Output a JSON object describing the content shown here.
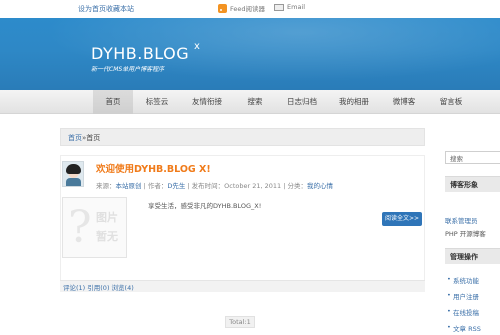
{
  "topbar": {
    "bookmark_link": "设为首页收藏本站",
    "feed_label": "Feed阅读器",
    "email_label": "Email",
    "feed_icon": "rss-icon",
    "email_icon": "mail-icon"
  },
  "header": {
    "site_name": "DYHB.BLOG",
    "close_glyph": "x",
    "tagline": "新一代CMS单用户博客程序",
    "brand_color": "#2e88c6"
  },
  "nav": {
    "items": [
      "首页",
      "标签云",
      "友情衔接",
      "搜索",
      "日志归档",
      "我的相册",
      "微博客",
      "留言板"
    ]
  },
  "breadcrumb": {
    "home": "首页",
    "separator": "»",
    "current": "首页"
  },
  "post": {
    "title": "欢迎使用DYHB.BLOG X!",
    "meta_source_label": "来源：",
    "meta_source": "本站原创",
    "meta_author_label": " | 作者：",
    "meta_author": "D先生",
    "meta_date": " | 发布时间：October 21, 2011 | 分类：",
    "meta_category": "我的心情",
    "thumb_placeholder_line1": "图片",
    "thumb_placeholder_line2": "暂无",
    "body": "享受生活，感受非凡的DYHB.BLOG_X!",
    "read_more": "阅读全文>>",
    "footer": "评论(1) 引用(0) 浏览(4)",
    "accent_color": "#f07b1a"
  },
  "pager": {
    "label": "Total:1"
  },
  "sidebar": {
    "search_value": "搜索",
    "section1_title": "博客形象",
    "links": [
      "联系管理员",
      "PHP 开源博客"
    ],
    "section2_title": "管理操作",
    "admin_items": [
      "系统功能",
      "用户注册",
      "在线投稿",
      "文章 RSS"
    ]
  }
}
